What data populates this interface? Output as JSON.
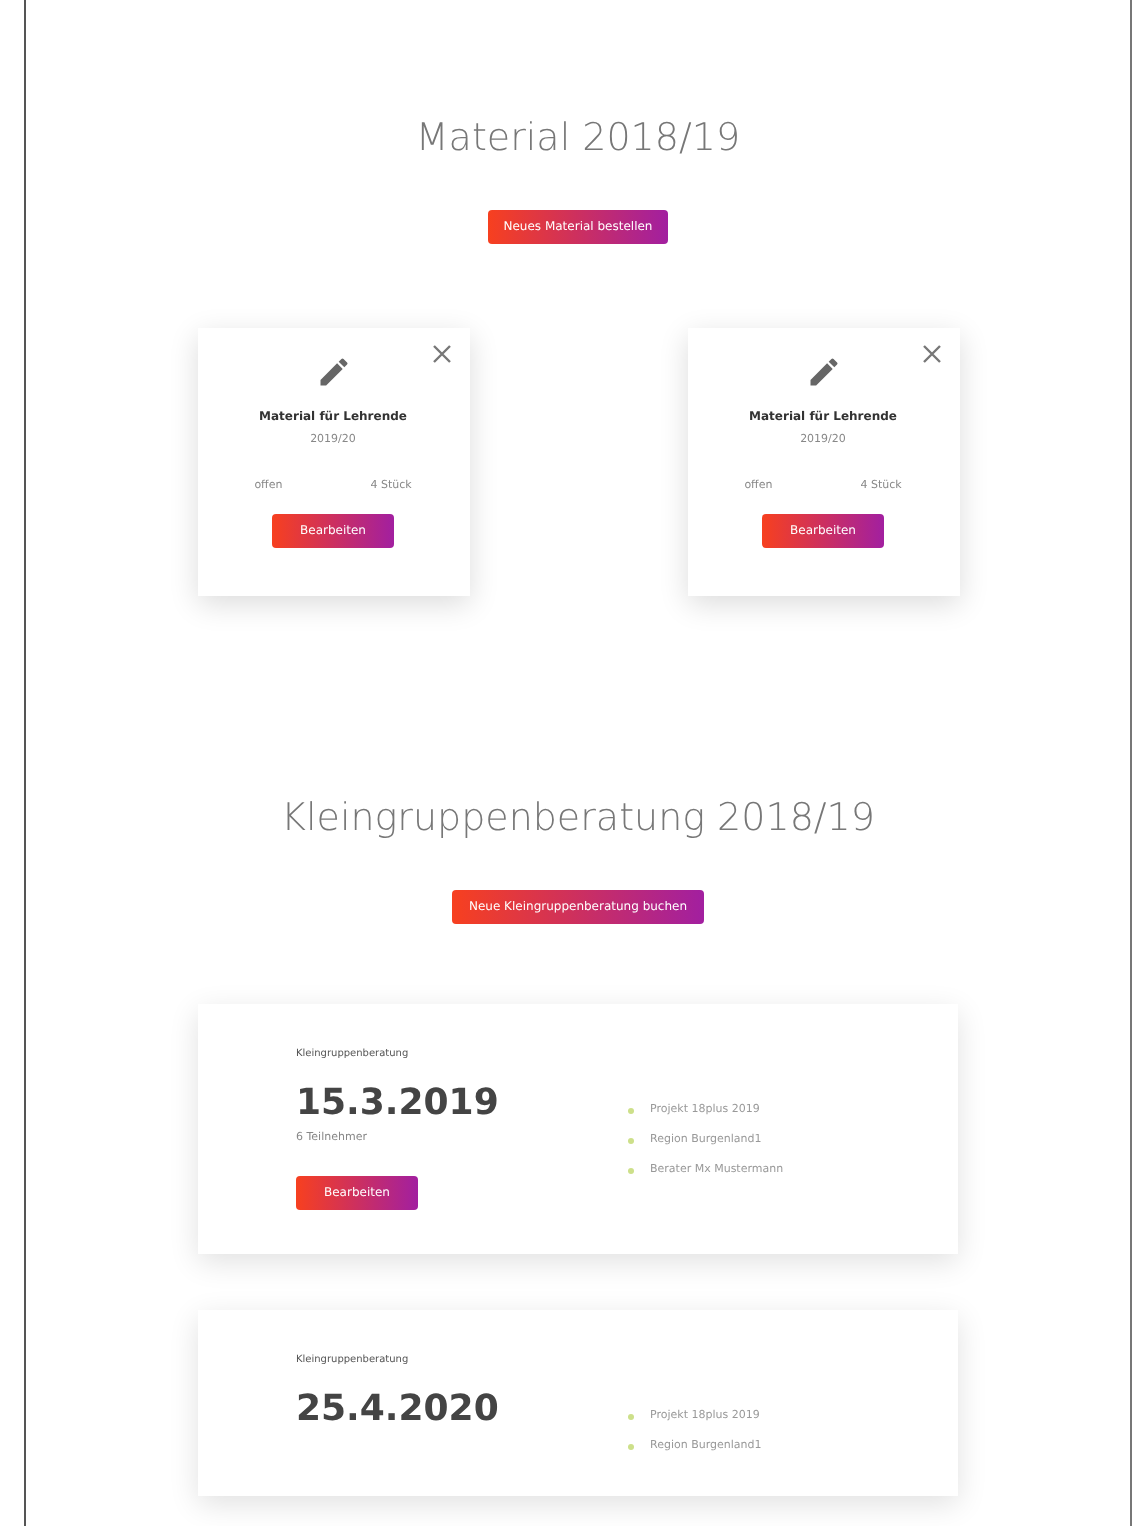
{
  "material": {
    "title": "Material 2018/19",
    "button": "Neues Material bestellen",
    "cards": [
      {
        "title": "Material für Lehrende",
        "year": "2019/20",
        "status": "offen",
        "quantity": "4 Stück",
        "button": "Bearbeiten"
      },
      {
        "title": "Material für Lehrende",
        "year": "2019/20",
        "status": "offen",
        "quantity": "4 Stück",
        "button": "Bearbeiten"
      }
    ]
  },
  "consulting": {
    "title": "Kleingruppenberatung 2018/19",
    "button": "Neue Kleingruppenberatung buchen",
    "cards": [
      {
        "label": "Kleingruppenberatung",
        "date": "15.3.2019",
        "participants": "6 Teilnehmer",
        "items": [
          "Projekt 18plus 2019",
          "Region Burgenland1",
          "Berater Mx Mustermann"
        ],
        "button": "Bearbeiten"
      },
      {
        "label": "Kleingruppenberatung",
        "date": "25.4.2020",
        "items": [
          "Projekt 18plus 2019",
          "Region Burgenland1"
        ]
      }
    ]
  }
}
